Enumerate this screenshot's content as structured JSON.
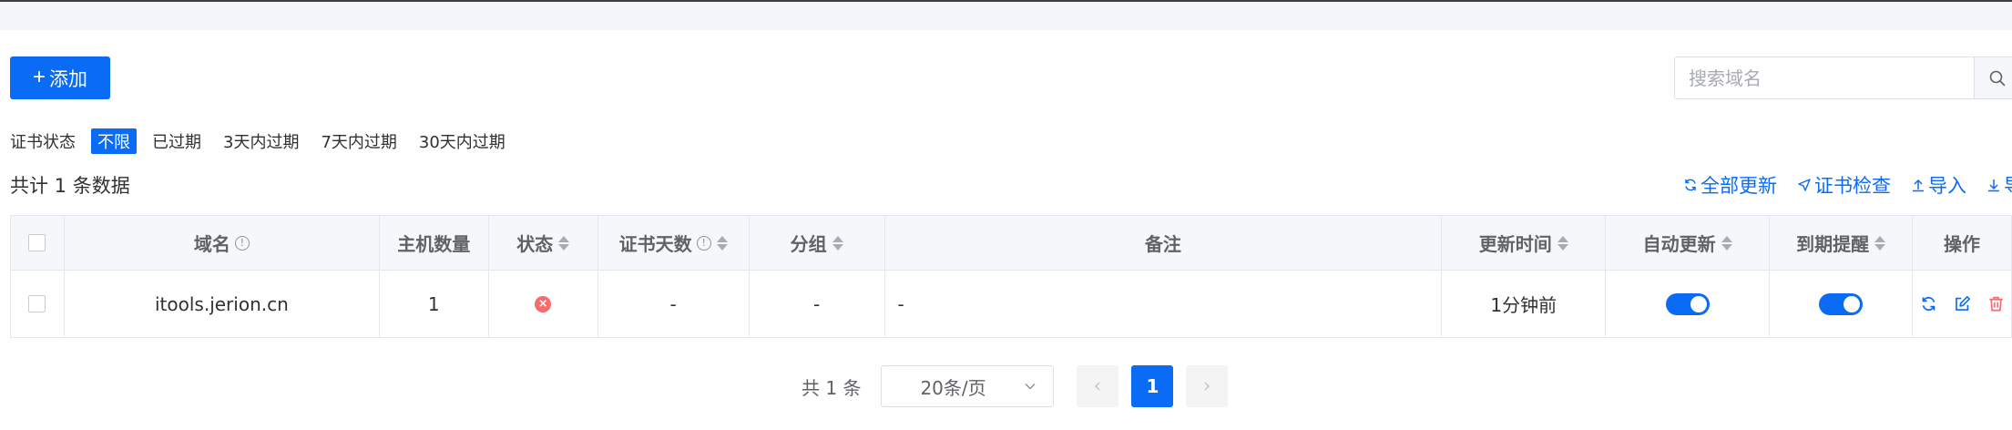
{
  "toolbar": {
    "add_label": "添加",
    "add_icon": "plus-icon",
    "search_placeholder": "搜索域名",
    "search_icon": "search-icon"
  },
  "filter": {
    "label": "证书状态",
    "options": [
      {
        "label": "不限",
        "active": true
      },
      {
        "label": "已过期",
        "active": false
      },
      {
        "label": "3天内过期",
        "active": false
      },
      {
        "label": "7天内过期",
        "active": false
      },
      {
        "label": "30天内过期",
        "active": false
      }
    ]
  },
  "summary": {
    "total_text": "共计 1 条数据"
  },
  "actions": [
    {
      "label": "全部更新",
      "icon": "refresh-icon"
    },
    {
      "label": "证书检查",
      "icon": "send-icon"
    },
    {
      "label": "导入",
      "icon": "upload-icon"
    },
    {
      "label": "导",
      "icon": "download-icon"
    }
  ],
  "table": {
    "headers": {
      "domain": "域名",
      "hosts": "主机数量",
      "status": "状态",
      "cert_days": "证书天数",
      "group": "分组",
      "remark": "备注",
      "updated": "更新时间",
      "auto_update": "自动更新",
      "expiry_alert": "到期提醒",
      "ops": "操作"
    },
    "rows": [
      {
        "domain": "itools.jerion.cn",
        "hosts": "1",
        "status": "error",
        "cert_days": "-",
        "group": "-",
        "remark": "-",
        "updated": "1分钟前",
        "auto_update": true,
        "expiry_alert": true
      }
    ]
  },
  "pagination": {
    "total_text": "共 1 条",
    "page_size": "20条/页",
    "current_page": "1",
    "prev_icon": "chevron-left-icon",
    "next_icon": "chevron-right-icon"
  },
  "colors": {
    "primary": "#0a6cf5",
    "danger": "#f56c6c",
    "header_bg": "#f5f7fa"
  }
}
